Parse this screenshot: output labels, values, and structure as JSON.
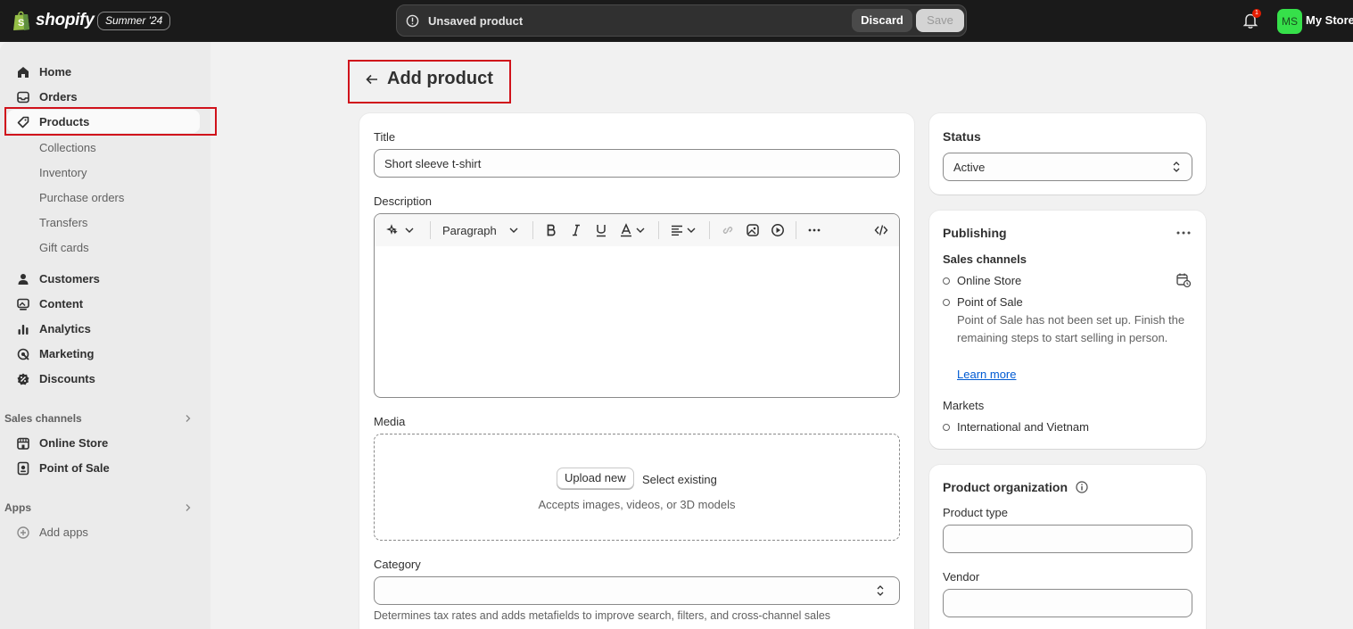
{
  "brand": {
    "name": "shopify",
    "edition": "Summer '24"
  },
  "topbar": {
    "unsaved_text": "Unsaved product",
    "discard_label": "Discard",
    "save_label": "Save",
    "notification_count": "1",
    "avatar_initials": "MS",
    "store_name": "My Store"
  },
  "sidebar": {
    "items": [
      {
        "label": "Home",
        "icon": "home-icon"
      },
      {
        "label": "Orders",
        "icon": "inbox-icon"
      },
      {
        "label": "Products",
        "icon": "tag-icon",
        "active": true
      },
      {
        "label": "Customers",
        "icon": "person-icon"
      },
      {
        "label": "Content",
        "icon": "image-icon"
      },
      {
        "label": "Analytics",
        "icon": "bar-chart-icon"
      },
      {
        "label": "Marketing",
        "icon": "target-icon"
      },
      {
        "label": "Discounts",
        "icon": "discount-icon"
      }
    ],
    "product_subitems": [
      "Collections",
      "Inventory",
      "Purchase orders",
      "Transfers",
      "Gift cards"
    ],
    "sales_channels_title": "Sales channels",
    "sales_channels": [
      {
        "label": "Online Store",
        "icon": "store-icon"
      },
      {
        "label": "Point of Sale",
        "icon": "pos-icon"
      }
    ],
    "apps_title": "Apps",
    "add_apps_label": "Add apps"
  },
  "page": {
    "title": "Add product"
  },
  "product_form": {
    "title_label": "Title",
    "title_value": "Short sleeve t-shirt",
    "description_label": "Description",
    "editor_paragraph": "Paragraph",
    "media_label": "Media",
    "upload_label": "Upload new",
    "select_existing_label": "Select existing",
    "media_helper": "Accepts images, videos, or 3D models",
    "category_label": "Category",
    "category_value": "",
    "category_helper": "Determines tax rates and adds metafields to improve search, filters, and cross-channel sales"
  },
  "status_card": {
    "title": "Status",
    "value": "Active"
  },
  "publishing": {
    "title": "Publishing",
    "sales_channels_label": "Sales channels",
    "channels": [
      "Online Store",
      "Point of Sale"
    ],
    "pos_note": "Point of Sale has not been set up. Finish the remaining steps to start selling in person.",
    "learn_more": "Learn more",
    "markets_label": "Markets",
    "markets_value": "International and Vietnam"
  },
  "organization": {
    "title": "Product organization",
    "product_type_label": "Product type",
    "product_type_value": "",
    "vendor_label": "Vendor",
    "vendor_value": ""
  },
  "colors": {
    "topbar": "#1a1a1a",
    "accent_link": "#005bd3",
    "highlight_box": "#d0121b",
    "avatar": "#36e04a"
  }
}
